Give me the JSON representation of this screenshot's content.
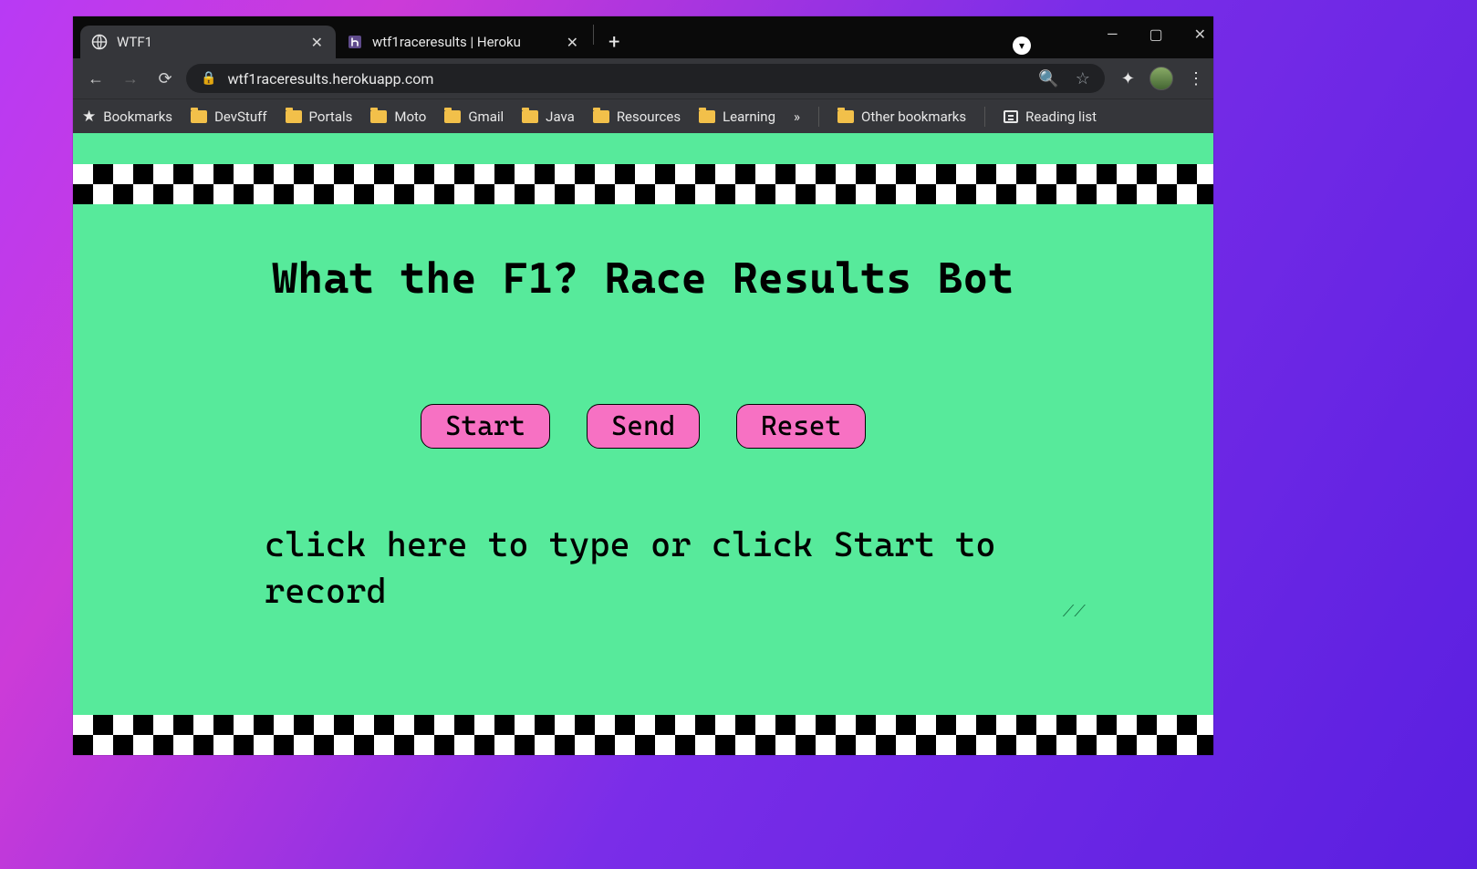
{
  "window": {
    "tabs": [
      {
        "title": "WTF1",
        "active": true
      },
      {
        "title": "wtf1raceresults | Heroku",
        "active": false
      }
    ],
    "url": "wtf1raceresults.herokuapp.com"
  },
  "bookmarks_bar": {
    "first": "Bookmarks",
    "folders": [
      "DevStuff",
      "Portals",
      "Moto",
      "Gmail",
      "Java",
      "Resources",
      "Learning"
    ],
    "overflow": "»",
    "other": "Other bookmarks",
    "reading": "Reading list"
  },
  "page": {
    "title": "What the F1? Race Results Bot",
    "buttons": {
      "start": "Start",
      "send": "Send",
      "reset": "Reset"
    },
    "textarea_placeholder": "click here to type or click Start to record"
  }
}
